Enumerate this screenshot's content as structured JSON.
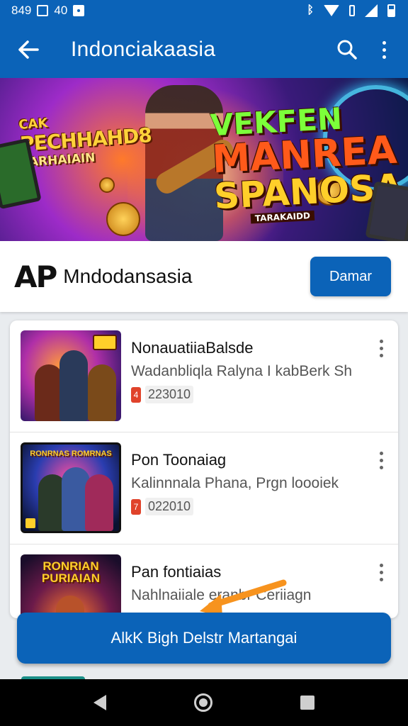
{
  "status_bar": {
    "time": "849",
    "extra": "40"
  },
  "app_bar": {
    "title": "Indonciakaasia"
  },
  "banner": {
    "left_line1": "CAK",
    "left_line2": "PECHHAHD8",
    "left_line3": "PARHAIAIN",
    "right_line1": "VEKFEN",
    "right_line2": "MANREA",
    "right_line3": "SPANOSA",
    "right_tag": "TARAKAIDD"
  },
  "app_header": {
    "logo": "AP",
    "name": "Mndodansasia",
    "action_label": "Damar"
  },
  "list": {
    "items": [
      {
        "thumb_title": "",
        "title": "NonauatiiaBalsde",
        "subtitle": "Wadanbliqla Ralyna I kabBerk Sh",
        "meta": "223010",
        "badge": "4"
      },
      {
        "thumb_title": "RONRNAS ROMRNAS",
        "title": "Pon Toonaiag",
        "subtitle": "Kalinnnala Phana, Prgn loooiek",
        "meta": "022010",
        "badge": "7"
      },
      {
        "thumb_title": "RONRIAN PURIAIAN",
        "title": "Pan fontiaias",
        "subtitle": "Nahlnaiiale eranbr Ceriiagn",
        "meta": "",
        "badge": ""
      }
    ]
  },
  "action_button": {
    "label": "AlkK Bigh Delstr Martangai"
  },
  "colors": {
    "primary": "#0b63b8",
    "accent_arrow": "#f7931e",
    "badge": "#e0432b"
  }
}
